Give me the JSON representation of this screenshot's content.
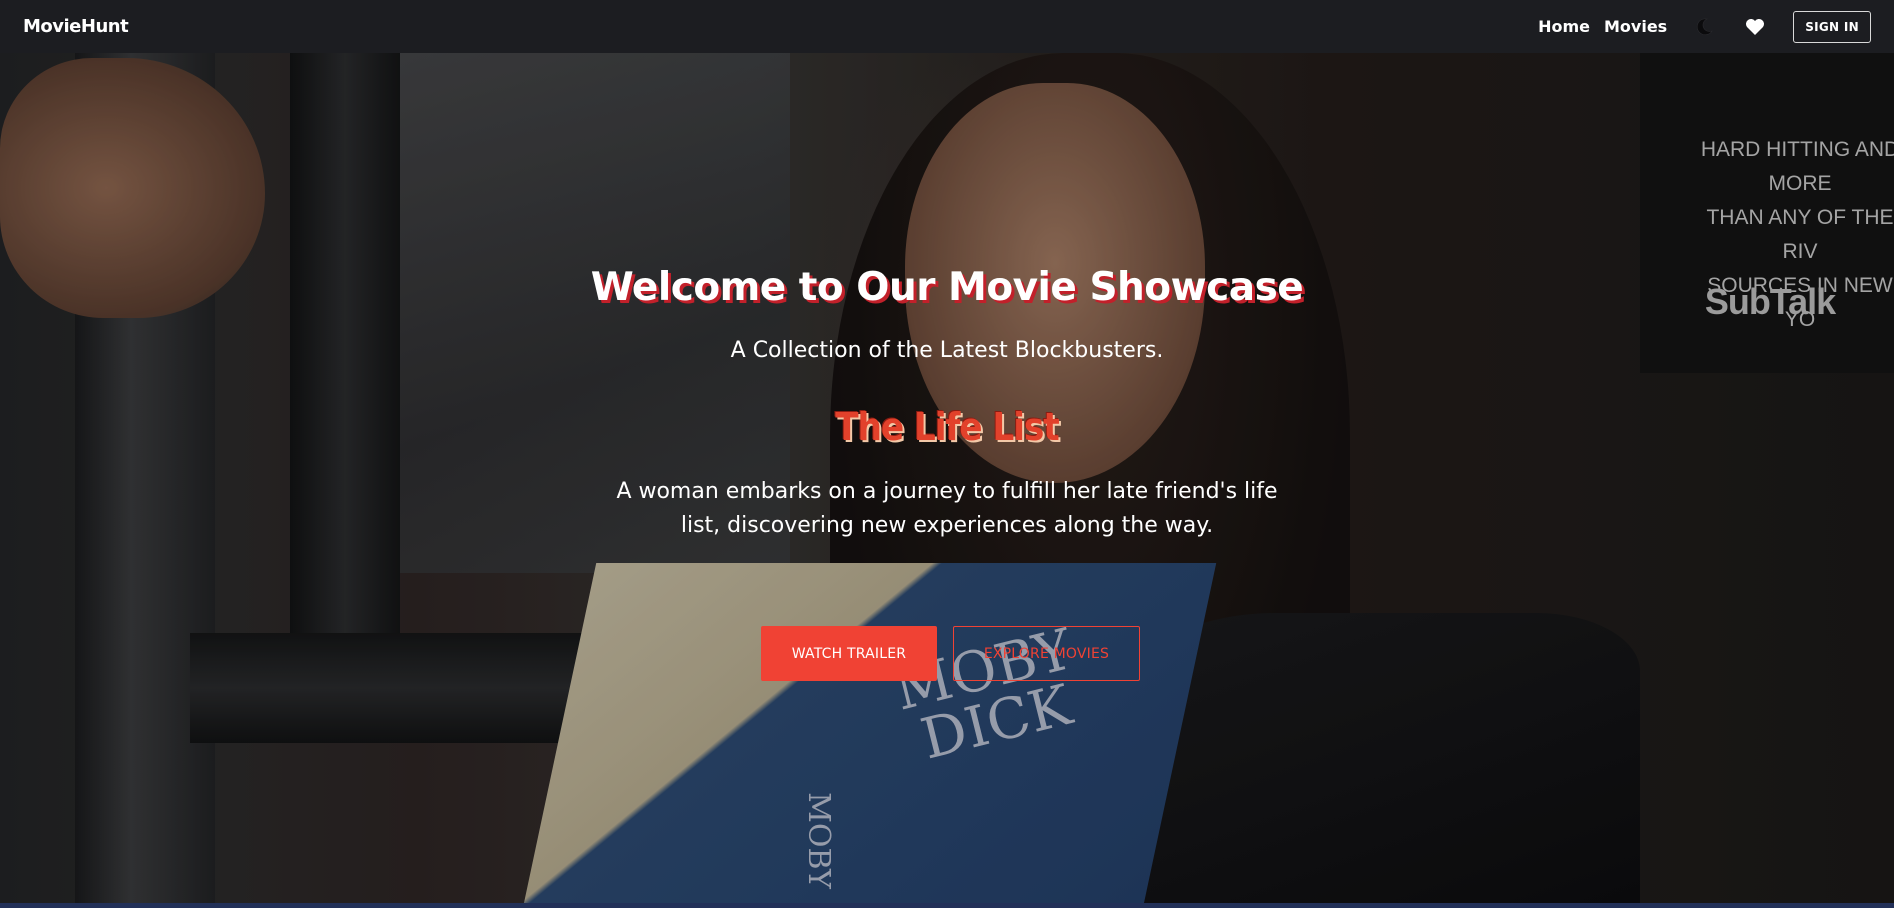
{
  "navbar": {
    "brand": "MovieHunt",
    "links": [
      "Home",
      "Movies"
    ],
    "icons": [
      "moon-icon",
      "heart-icon"
    ],
    "signin_label": "SIGN IN"
  },
  "hero": {
    "title": "Welcome to Our Movie Showcase",
    "subtitle": "A Collection of the Latest Blockbusters.",
    "movie_title": "The Life List",
    "movie_description": "A woman embarks on a journey to fulfill her late friend's life list, discovering new experiences along the way.",
    "primary_button": "WATCH TRAILER",
    "secondary_button": "EXPLORE MOVIES"
  },
  "background": {
    "ad_lines": [
      "HARD HITTING AND MORE",
      "THAN ANY OF THE RIV",
      "SOURCES IN NEW YO"
    ],
    "ad_brand": "SubTalk",
    "book_title_lines": [
      "MOBY",
      "DICK"
    ],
    "book_spine": "MOBY"
  },
  "colors": {
    "accent": "#f04234",
    "navbar_bg": "#1c1d21",
    "title_shadow": "#c2202a"
  }
}
